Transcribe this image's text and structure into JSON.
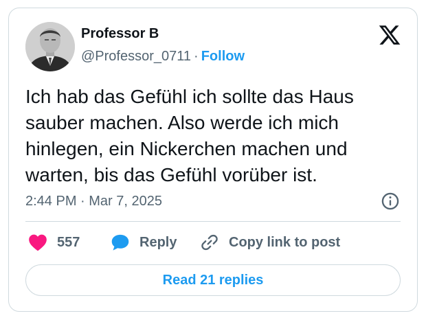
{
  "author": {
    "name": "Professor B",
    "handle": "@Professor_0711",
    "separator": "·",
    "follow_label": "Follow"
  },
  "tweet": {
    "text_lines": [
      "Ich hab das Gefühl ich sollte das Haus",
      "sauber machen. Also werde ich mich",
      "hinlegen, ein Nickerchen machen und",
      "warten, bis das Gefühl vorüber ist."
    ],
    "timestamp": "2:44 PM · Mar 7, 2025"
  },
  "actions": {
    "like_count": "557",
    "reply_label": "Reply",
    "copy_link_label": "Copy link to post"
  },
  "read_replies_label": "Read 21 replies",
  "icons": {
    "brand": "x-logo-icon",
    "info": "info-icon",
    "like": "heart-icon",
    "reply": "speech-bubble-icon",
    "copy": "link-icon"
  },
  "colors": {
    "accent": "#1d9bf0",
    "like": "#f91880",
    "muted_text": "#536471",
    "border": "#cfd9de"
  }
}
